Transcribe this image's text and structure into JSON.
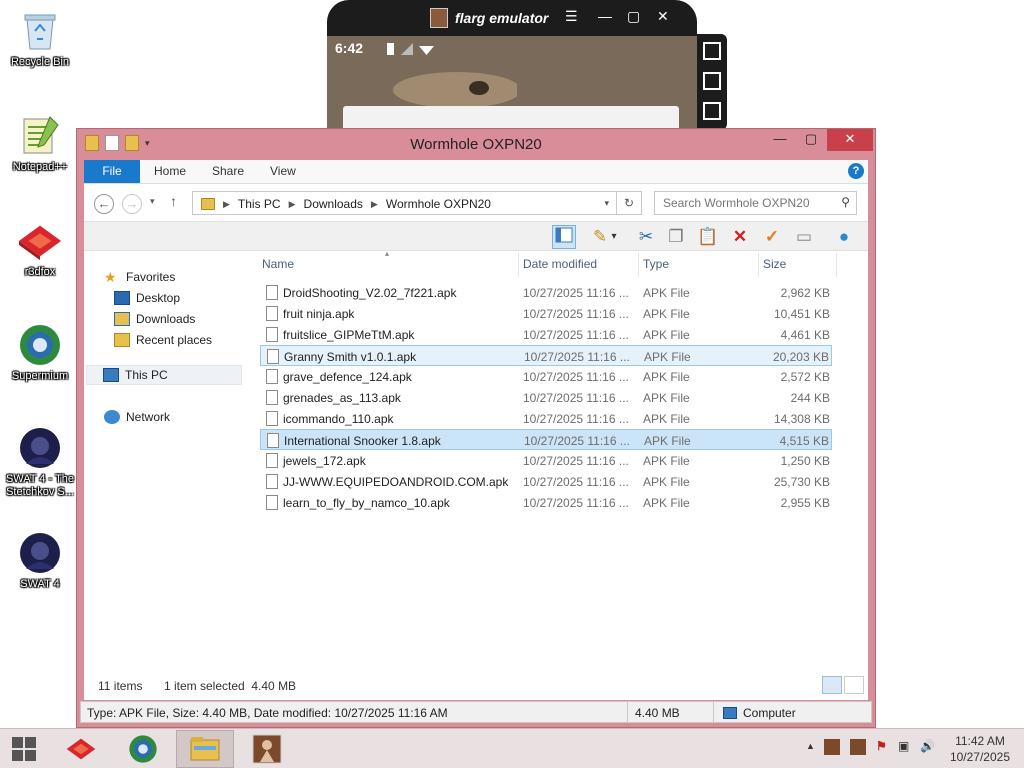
{
  "desktop": {
    "icons": [
      {
        "label": "Recycle Bin"
      },
      {
        "label": "Notepad++"
      },
      {
        "label": "r3dfox"
      },
      {
        "label": "Supermium"
      },
      {
        "label": "SWAT 4 - The Stetchkov S..."
      },
      {
        "label": "SWAT 4"
      }
    ]
  },
  "emulator": {
    "title": "flarg emulator",
    "status_time": "6:42"
  },
  "explorer": {
    "title": "Wormhole OXPN20",
    "tabs": [
      "File",
      "Home",
      "Share",
      "View"
    ],
    "help": "?",
    "breadcrumb": [
      "This PC",
      "Downloads",
      "Wormhole OXPN20"
    ],
    "search_placeholder": "Search Wormhole OXPN20",
    "nav": {
      "favorites": "Favorites",
      "desktop": "Desktop",
      "downloads": "Downloads",
      "recent": "Recent places",
      "thispc": "This PC",
      "network": "Network"
    },
    "columns": {
      "name": "Name",
      "date": "Date modified",
      "type": "Type",
      "size": "Size"
    },
    "files": [
      {
        "name": "DroidShooting_V2.02_7f221.apk",
        "date": "10/27/2025 11:16 ...",
        "type": "APK File",
        "size": "2,962 KB"
      },
      {
        "name": "fruit ninja.apk",
        "date": "10/27/2025 11:16 ...",
        "type": "APK File",
        "size": "10,451 KB"
      },
      {
        "name": "fruitslice_GIPMeTtM.apk",
        "date": "10/27/2025 11:16 ...",
        "type": "APK File",
        "size": "4,461 KB"
      },
      {
        "name": "Granny Smith v1.0.1.apk",
        "date": "10/27/2025 11:16 ...",
        "type": "APK File",
        "size": "20,203 KB"
      },
      {
        "name": "grave_defence_124.apk",
        "date": "10/27/2025 11:16 ...",
        "type": "APK File",
        "size": "2,572 KB"
      },
      {
        "name": "grenades_as_113.apk",
        "date": "10/27/2025 11:16 ...",
        "type": "APK File",
        "size": "244 KB"
      },
      {
        "name": "icommando_110.apk",
        "date": "10/27/2025 11:16 ...",
        "type": "APK File",
        "size": "14,308 KB"
      },
      {
        "name": "International Snooker 1.8.apk",
        "date": "10/27/2025 11:16 ...",
        "type": "APK File",
        "size": "4,515 KB"
      },
      {
        "name": "jewels_172.apk",
        "date": "10/27/2025 11:16 ...",
        "type": "APK File",
        "size": "1,250 KB"
      },
      {
        "name": "JJ-WWW.EQUIPEDOANDROID.COM.apk",
        "date": "10/27/2025 11:16 ...",
        "type": "APK File",
        "size": "25,730 KB"
      },
      {
        "name": "learn_to_fly_by_namco_10.apk",
        "date": "10/27/2025 11:16 ...",
        "type": "APK File",
        "size": "2,955 KB"
      }
    ],
    "status": {
      "count": "11 items",
      "selected": "1 item selected  4.40 MB"
    },
    "details": {
      "text": "Type: APK File, Size: 4.40 MB, Date modified: 10/27/2025 11:16 AM",
      "size": "4.40 MB",
      "location": "Computer"
    }
  },
  "taskbar": {
    "time": "11:42 AM",
    "date": "10/27/2025"
  }
}
